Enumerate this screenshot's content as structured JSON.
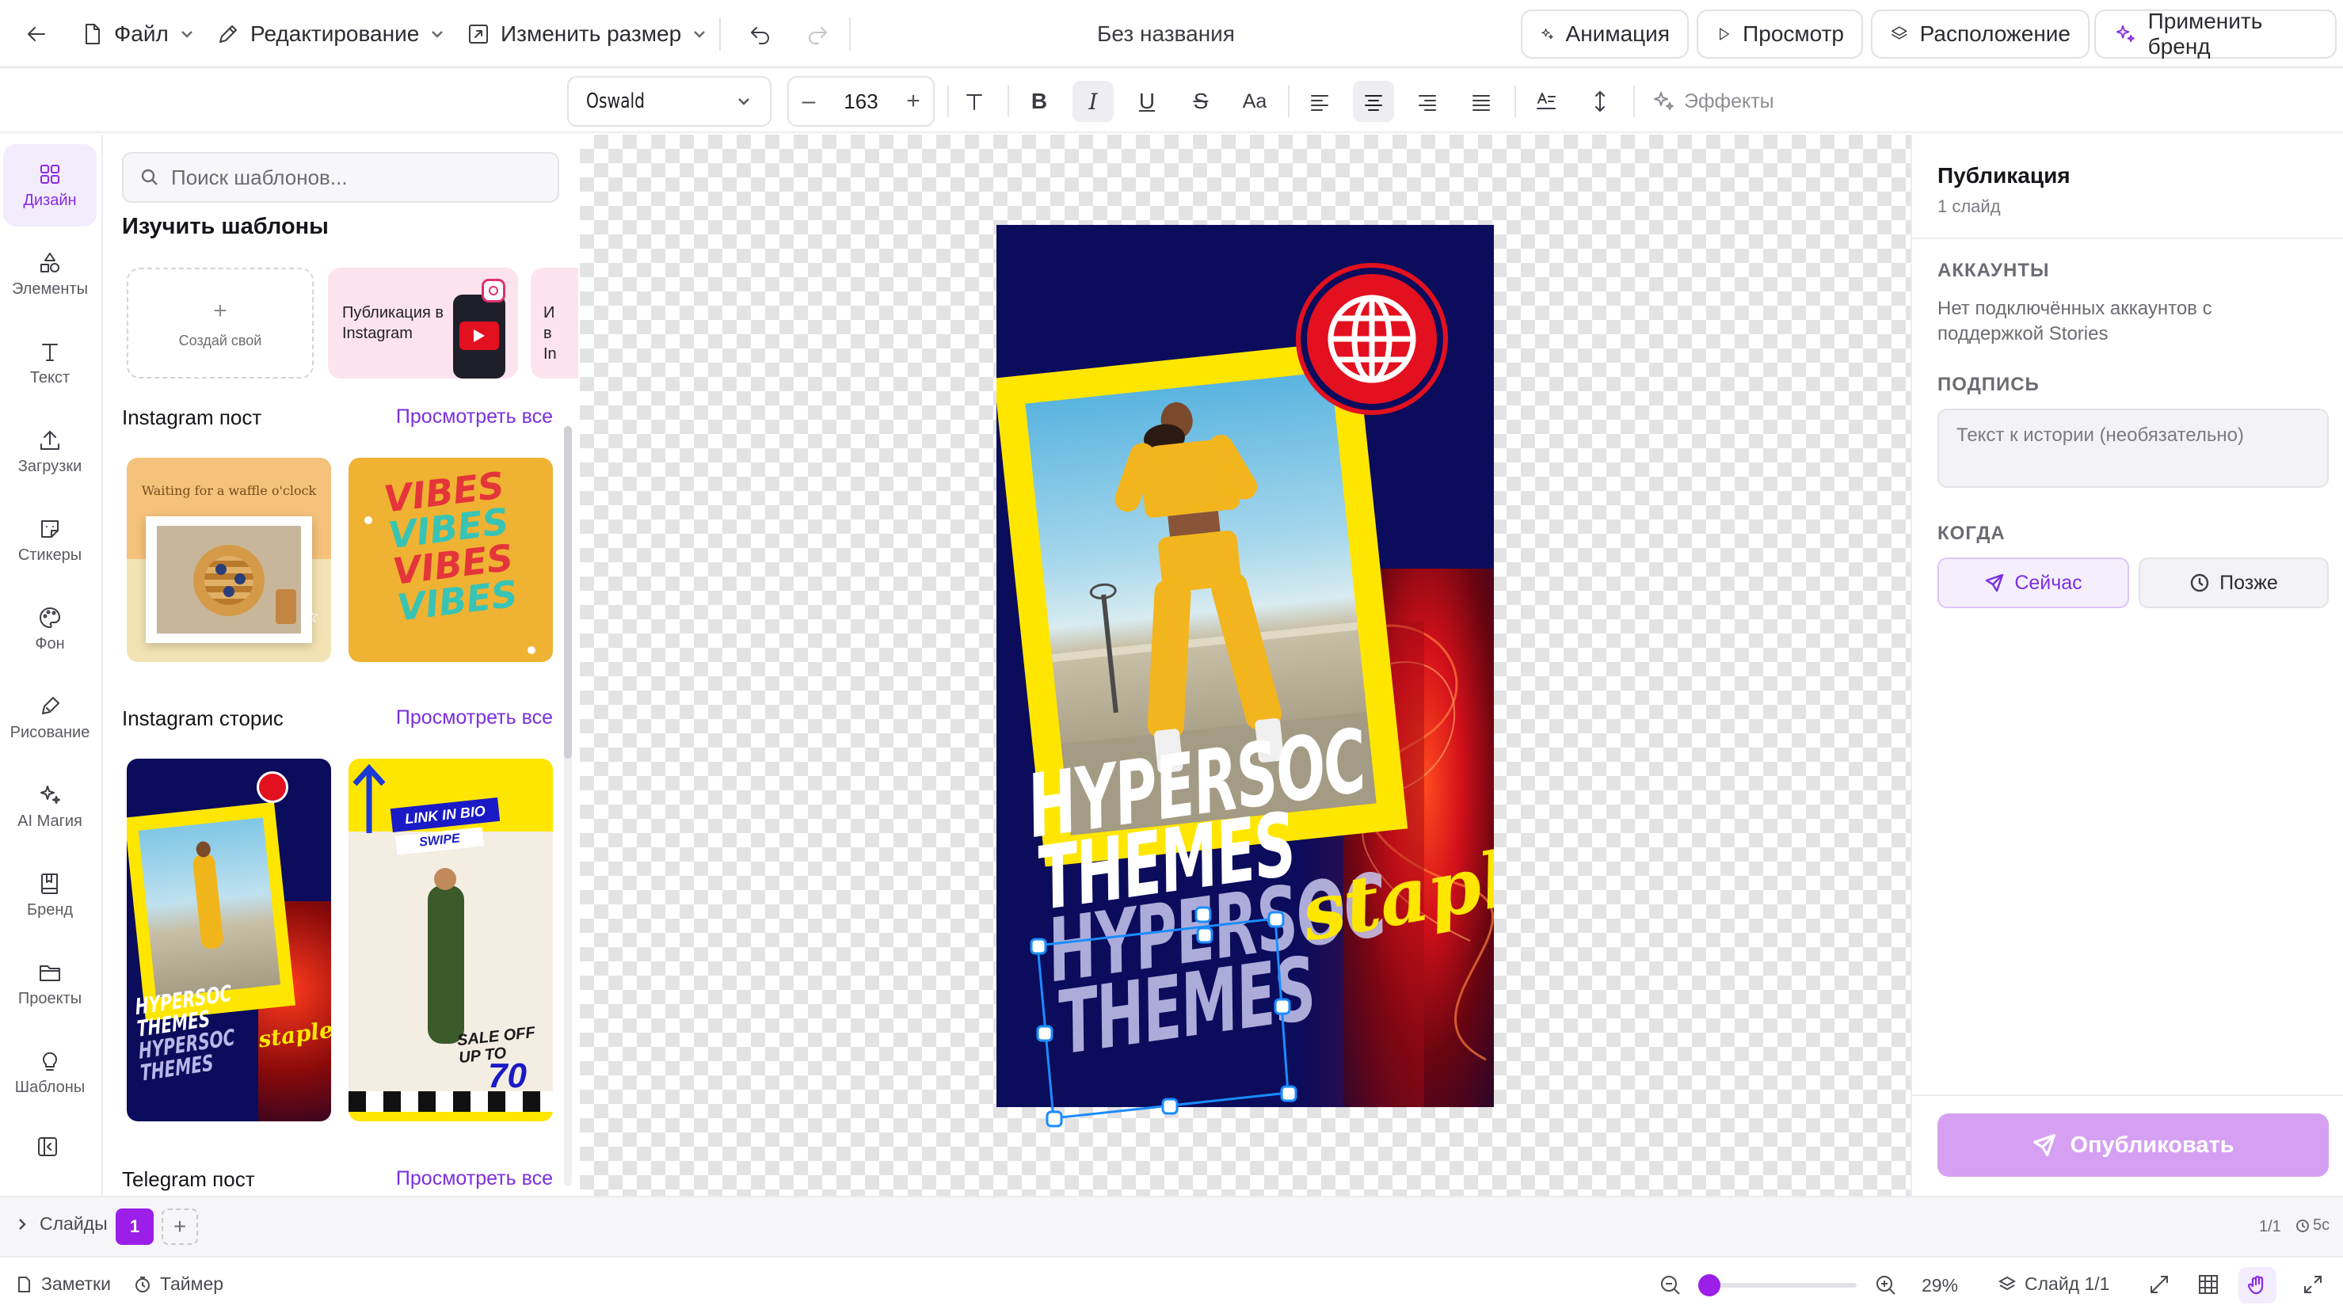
{
  "topbar": {
    "file": "Файл",
    "edit": "Редактирование",
    "resize": "Изменить размер",
    "doc_title": "Без названия",
    "animation": "Анимация",
    "preview": "Просмотр",
    "arrange": "Расположение",
    "apply_brand": "Применить бренд"
  },
  "format": {
    "font": "Oswald",
    "size": "163",
    "case": "Aa",
    "effects": "Эффекты"
  },
  "rail": {
    "items": [
      {
        "label": "Дизайн",
        "icon": "grid-icon"
      },
      {
        "label": "Элементы",
        "icon": "shapes-icon"
      },
      {
        "label": "Текст",
        "icon": "text-icon"
      },
      {
        "label": "Загрузки",
        "icon": "upload-icon"
      },
      {
        "label": "Стикеры",
        "icon": "sticker-icon"
      },
      {
        "label": "Фон",
        "icon": "palette-icon"
      },
      {
        "label": "Рисование",
        "icon": "pen-icon"
      },
      {
        "label": "AI Магия",
        "icon": "sparkles-icon"
      },
      {
        "label": "Бренд",
        "icon": "book-icon"
      },
      {
        "label": "Проекты",
        "icon": "folder-icon"
      },
      {
        "label": "Шаблоны",
        "icon": "lightbulb-icon"
      }
    ]
  },
  "panel": {
    "search_placeholder": "Поиск шаблонов...",
    "explore_title": "Изучить шаблоны",
    "create_own": "Создай свой",
    "format_1": "Публикация в Instagram",
    "format_2_partial": "И в In",
    "sections": [
      {
        "title": "Instagram пост",
        "see_all": "Просмотреть все"
      },
      {
        "title": "Instagram сторис",
        "see_all": "Просмотреть все"
      },
      {
        "title": "Telegram пост",
        "see_all": "Просмотреть все"
      }
    ],
    "thumb_waffle_text": "Waiting for a waffle o'clock",
    "thumb_vibes": [
      "VIBES",
      "VIBES",
      "VIBES",
      "VIBES"
    ],
    "thumb_story_lines": [
      "HYPERSOC",
      "THEMES",
      "HYPERSOC",
      "THEMES"
    ],
    "thumb_story_script": "staple",
    "thumb_sale": [
      "LINK IN BIO",
      "SWIPE",
      "SALE OFF",
      "UP TO",
      "70"
    ]
  },
  "design": {
    "line1": "HYPERSOC",
    "line2": "THEMES",
    "line3": "HYPERSOC",
    "line4": "THEMES",
    "script": "staple"
  },
  "right": {
    "title": "Публикация",
    "subtitle": "1 слайд",
    "accounts_label": "АККАУНТЫ",
    "accounts_text": "Нет подключённых аккаунтов с поддержкой Stories",
    "caption_label": "ПОДПИСЬ",
    "caption_placeholder": "Текст к истории (необязательно)",
    "when_label": "КОГДА",
    "now": "Сейчас",
    "later": "Позже",
    "publish": "Опубликовать"
  },
  "slides": {
    "label": "Слайды",
    "current": "1",
    "counter": "1/1",
    "duration": "5с"
  },
  "status": {
    "notes": "Заметки",
    "timer": "Таймер",
    "zoom": "29%",
    "slide": "Слайд 1/1"
  },
  "colors": {
    "accent": "#8a2be2",
    "navy": "#0b0c5c",
    "yellow": "#ffe600",
    "red": "#e3101f"
  }
}
